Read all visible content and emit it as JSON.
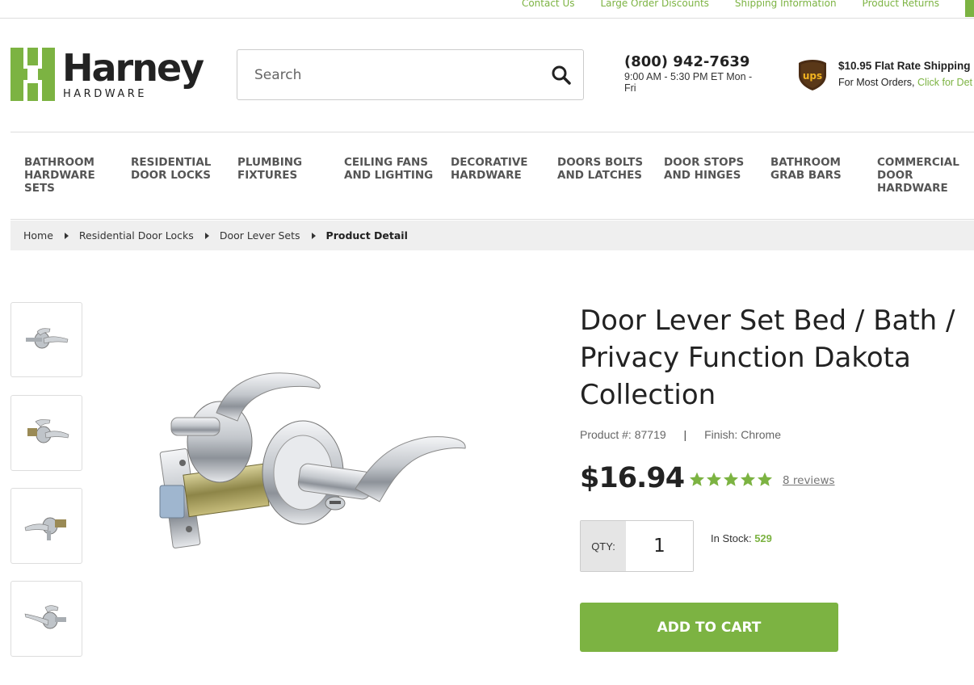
{
  "top_links": [
    "Contact Us",
    "Large Order Discounts",
    "Shipping Information",
    "Product Returns"
  ],
  "logo": {
    "word": "Harney",
    "sub": "HARDWARE"
  },
  "search": {
    "placeholder": "Search",
    "icon": "search-icon"
  },
  "contact": {
    "phone": "(800) 942-7639",
    "hours": "9:00 AM - 5:30 PM ET Mon - Fri"
  },
  "shipping": {
    "headline": "$10.95 Flat Rate Shipping",
    "subline": "For Most Orders, ",
    "link": "Click for Det"
  },
  "nav": [
    "BATHROOM HARDWARE SETS",
    "RESIDENTIAL DOOR LOCKS",
    "PLUMBING FIXTURES",
    "CEILING FANS AND LIGHTING",
    "DECORATIVE HARDWARE",
    "DOORS BOLTS AND LATCHES",
    "DOOR STOPS AND HINGES",
    "BATHROOM GRAB BARS",
    "COMMERCIAL DOOR HARDWARE"
  ],
  "breadcrumb": {
    "items": [
      "Home",
      "Residential Door Locks",
      "Door Lever Sets"
    ],
    "current": "Product Detail"
  },
  "product": {
    "title": "Door Lever Set Bed / Bath / Privacy Function Dakota Collection",
    "product_number_label": "Product #:",
    "product_number": "87719",
    "finish_label": "Finish:",
    "finish": "Chrome",
    "price": "$16.94",
    "rating": 5,
    "reviews": "8 reviews",
    "qty_label": "QTY:",
    "qty": "1",
    "stock_label": "In Stock:",
    "stock": "529",
    "add_to_cart": "ADD TO CART"
  },
  "colors": {
    "accent": "#7cb342",
    "text": "#222222",
    "nav_text": "#555555",
    "breadcrumb_bg": "#efefef"
  }
}
